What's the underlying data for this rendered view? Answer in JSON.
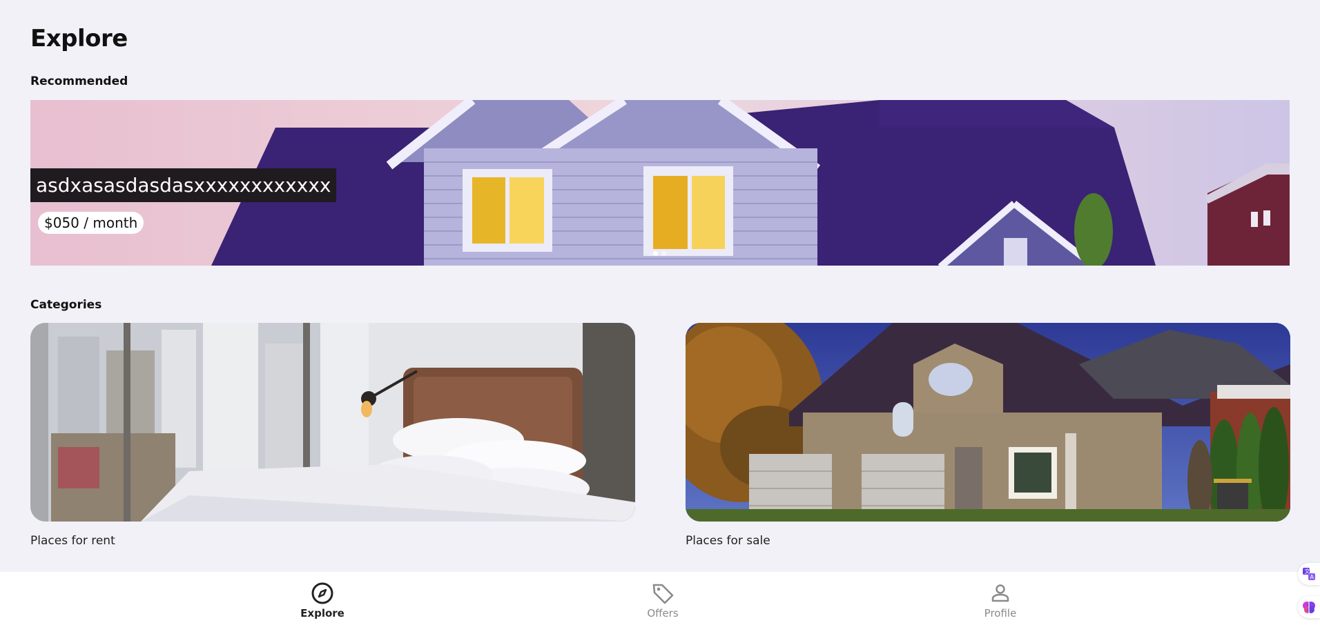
{
  "page": {
    "title": "Explore"
  },
  "recommended": {
    "label": "Recommended",
    "slide_title": "asdxasasdasdasxxxxxxxxxxxx",
    "slide_price": "$050 / month",
    "slide_count": 2,
    "active_slide": 1
  },
  "categories": {
    "label": "Categories",
    "items": [
      {
        "caption": "Places for rent",
        "image": "bedroom-photo"
      },
      {
        "caption": "Places for sale",
        "image": "house-photo"
      }
    ]
  },
  "bottom_nav": {
    "items": [
      {
        "label": "Explore",
        "icon": "compass-icon",
        "active": true
      },
      {
        "label": "Offers",
        "icon": "tag-icon",
        "active": false
      },
      {
        "label": "Profile",
        "icon": "person-icon",
        "active": false
      }
    ]
  },
  "side_tools": [
    {
      "icon": "translate-icon"
    },
    {
      "icon": "brain-icon"
    }
  ],
  "colors": {
    "background": "#f1f1f7",
    "nav_background": "#ffffff",
    "nav_active": "#222222",
    "nav_inactive": "#8a8a8a"
  }
}
